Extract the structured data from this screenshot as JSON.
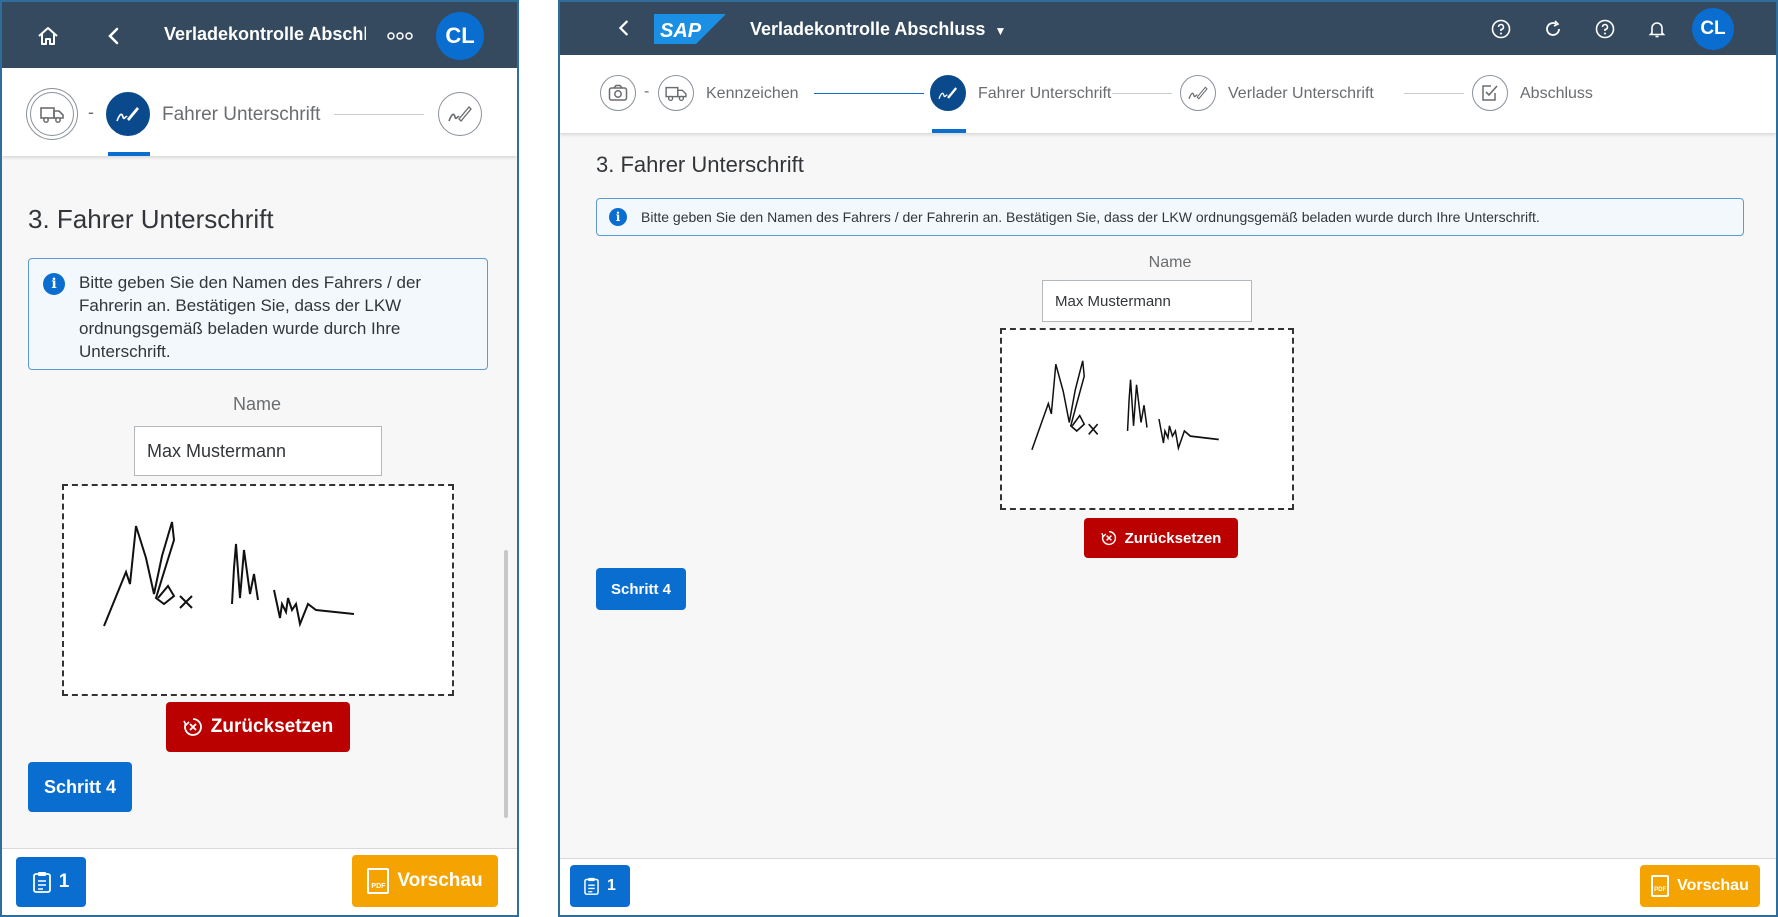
{
  "app": {
    "title_full": "Verladekontrolle Abschluss",
    "title_truncated": "Verladekontrolle Abschl",
    "avatar_initials": "CL",
    "logo_text": "SAP"
  },
  "steps": [
    {
      "label": "Kennzeichen",
      "icon": "truck-icon",
      "state": "done"
    },
    {
      "label": "Fahrer Unterschrift",
      "icon": "signature-icon",
      "state": "active"
    },
    {
      "label": "Verlader Unterschrift",
      "icon": "signature-icon",
      "state": "pending"
    },
    {
      "label": "Abschluss",
      "icon": "checkbox-icon",
      "state": "pending"
    }
  ],
  "step_icons": {
    "camera": "camera-icon"
  },
  "separator": "-",
  "section": {
    "title": "3. Fahrer Unterschrift",
    "info_mobile": "Bitte geben Sie den Namen des Fahrers / der Fahrerin an. Bestätigen Sie, dass der LKW ordnungsgemäß beladen wurde durch Ihre Unterschrift.",
    "info_desktop": "Bitte geben Sie den Namen des Fahrers / der Fahrerin an. Bestätigen Sie, dass der LKW ordnungsgemäß beladen wurde durch Ihre Unterschrift."
  },
  "form": {
    "name_label": "Name",
    "name_value": "Max Mustermann",
    "reset_label": "Zurücksetzen",
    "next_label": "Schritt 4"
  },
  "footer": {
    "list_count": "1",
    "preview_label": "Vorschau",
    "pdf_text": "PDF"
  },
  "colors": {
    "shell": "#354a5f",
    "accent": "#0a6ed1",
    "active_step": "#0a4a8c",
    "reject": "#bb0000",
    "preview": "#f5a300"
  }
}
